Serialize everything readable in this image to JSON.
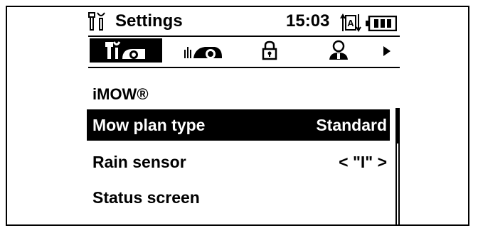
{
  "header": {
    "title": "Settings",
    "time": "15:03",
    "icons": [
      "settings-icon",
      "auto-mode-icon",
      "battery-icon"
    ]
  },
  "tabs": [
    {
      "name": "settings-tab",
      "icon": "tools-gauge-icon",
      "active": true
    },
    {
      "name": "mower-tab",
      "icon": "mower-icon",
      "active": false
    },
    {
      "name": "lock-tab",
      "icon": "padlock-icon",
      "active": false
    },
    {
      "name": "user-tab",
      "icon": "user-icon",
      "active": false
    }
  ],
  "section_title": "iMOW®",
  "menu": [
    {
      "label": "Mow plan type",
      "value": "Standard",
      "selected": true
    },
    {
      "label": "Rain sensor",
      "value": "< \"I\" >",
      "selected": false
    },
    {
      "label": "Status screen",
      "value": "",
      "selected": false
    }
  ],
  "scroll": {
    "fraction_visible": 0.3
  }
}
